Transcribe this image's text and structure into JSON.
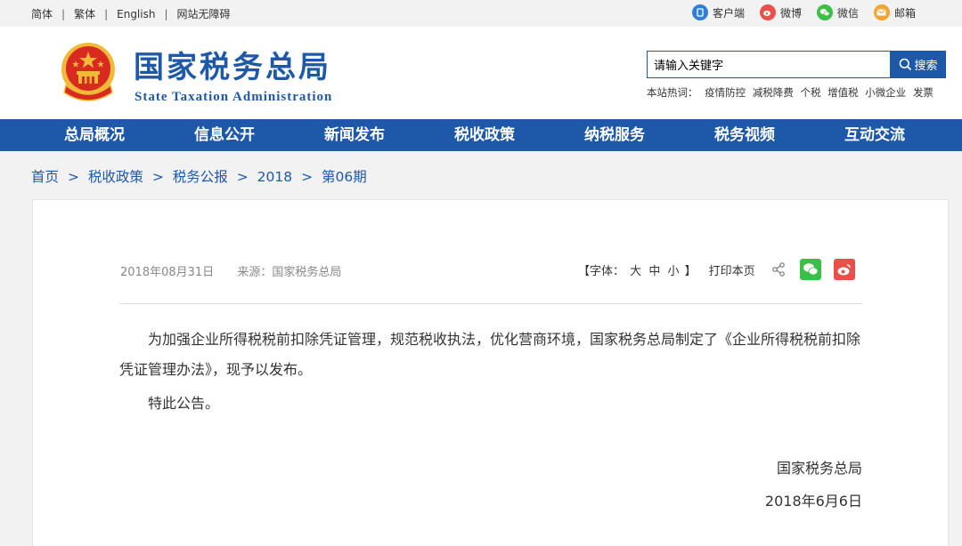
{
  "topbar": {
    "links": [
      "简体",
      "繁体",
      "English",
      "网站无障碍"
    ],
    "separator": "|",
    "right": [
      {
        "label": "客户端",
        "icon": "client-icon",
        "color": "#2f7fd6"
      },
      {
        "label": "微博",
        "icon": "weibo-icon",
        "color": "#e8504a"
      },
      {
        "label": "微信",
        "icon": "wechat-icon",
        "color": "#3bbf46"
      },
      {
        "label": "邮箱",
        "icon": "mail-icon",
        "color": "#f0a431"
      }
    ]
  },
  "header": {
    "logo_cn": "国家税务总局",
    "logo_en": "State Taxation Administration",
    "search_value": "请输入关键字",
    "search_button": "搜索",
    "hot_label": "本站热词：",
    "hot_words": [
      "疫情防控",
      "减税降费",
      "个税",
      "增值税",
      "小微企业",
      "发票"
    ]
  },
  "nav": [
    "总局概况",
    "信息公开",
    "新闻发布",
    "税收政策",
    "纳税服务",
    "税务视频",
    "互动交流"
  ],
  "breadcrumb": [
    "首页",
    "税收政策",
    "税务公报",
    "2018",
    "第06期"
  ],
  "breadcrumb_sep": ">",
  "article": {
    "date": "2018年08月31日",
    "source": "来源：国家税务总局",
    "font_label": "【字体：",
    "font_sizes": [
      "大",
      "中",
      "小"
    ],
    "font_close": "】",
    "print": "打印本页",
    "paragraph1": "为加强企业所得税税前扣除凭证管理，规范税收执法，优化营商环境，国家税务总局制定了《企业所得税税前扣除凭证管理办法》，现予以发布。",
    "paragraph2": "特此公告。",
    "signature": "国家税务总局",
    "sign_date": "2018年6月6日"
  },
  "colors": {
    "brand_blue": "#1e58a8",
    "emblem_red": "#d62b1e",
    "emblem_gold": "#f2b83a"
  }
}
